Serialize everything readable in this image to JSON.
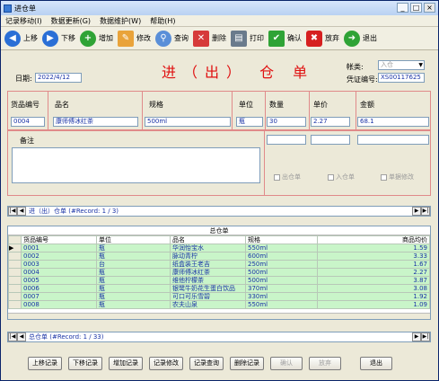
{
  "window": {
    "title": "进仓单",
    "buttons": {
      "min": "_",
      "max": "□",
      "close": "×"
    }
  },
  "menu": [
    "记录移动(I)",
    "数据更新(G)",
    "数据维护(W)",
    "帮助(H)"
  ],
  "toolbar": [
    {
      "label": "上移",
      "icon": "arrow-left-icon",
      "color": "#2a6fd6"
    },
    {
      "label": "下移",
      "icon": "arrow-right-icon",
      "color": "#2a6fd6"
    },
    {
      "label": "增加",
      "icon": "plus-icon",
      "color": "#2fa336"
    },
    {
      "label": "修改",
      "icon": "pencil-icon",
      "color": "#e9a33a"
    },
    {
      "label": "查询",
      "icon": "magnifier-icon",
      "color": "#5a8fd8"
    },
    {
      "label": "删除",
      "icon": "delete-doc-icon",
      "color": "#d63a3a"
    },
    {
      "label": "打印",
      "icon": "printer-icon",
      "color": "#6a7b8c"
    },
    {
      "label": "确认",
      "icon": "checkmark-icon",
      "color": "#2fa336"
    },
    {
      "label": "放弃",
      "icon": "x-icon",
      "color": "#d62020"
    },
    {
      "label": "退出",
      "icon": "exit-arrow-icon",
      "color": "#2fa336"
    }
  ],
  "header": {
    "date_label": "日期:",
    "date_value": "2022/4/12",
    "title": "进（出） 仓 单",
    "type_label": "帐类:",
    "type_value": "入仓",
    "voucher_label": "凭证编号:",
    "voucher_value": "XS00117625"
  },
  "detail": {
    "headers": [
      "货品编号",
      "品名",
      "规格",
      "单位",
      "数量",
      "单价",
      "金额"
    ],
    "values": [
      "0004",
      "康师傅冰红茶",
      "500ml",
      "瓶",
      "30",
      "2.27",
      "68.1"
    ],
    "remark_label": "备注",
    "remark_value": "",
    "checks": [
      "出仓单",
      "入仓单",
      "单据修改"
    ]
  },
  "nav1": {
    "text": "进（出）仓单 (#Record: 1 / 3)"
  },
  "grid": {
    "title": "总仓单",
    "columns": [
      "货品编号",
      "单位",
      "品名",
      "规格",
      "商品均价"
    ],
    "rows": [
      [
        "0001",
        "瓶",
        "华润怡宝水",
        "550ml",
        "1.59"
      ],
      [
        "0002",
        "瓶",
        "脉动青柠",
        "600ml",
        "3.33"
      ],
      [
        "0003",
        "台",
        "纸盒装王老吉",
        "250ml",
        "1.67"
      ],
      [
        "0004",
        "瓶",
        "康师傅冰红茶",
        "500ml",
        "2.27"
      ],
      [
        "0005",
        "瓶",
        "维他柠檬茶",
        "500ml",
        "3.87"
      ],
      [
        "0006",
        "瓶",
        "银鹭牛奶花生蛋白饮品",
        "370ml",
        "3.08"
      ],
      [
        "0007",
        "瓶",
        "可口可乐雪碧",
        "330ml",
        "1.92"
      ],
      [
        "0008",
        "瓶",
        "农夫山泉",
        "550ml",
        "1.09"
      ]
    ]
  },
  "nav2": {
    "text": "总仓单 (#Record: 1 / 33)"
  },
  "buttons": [
    "上移记录",
    "下移记录",
    "增加记录",
    "记录修改",
    "记录查询",
    "删除记录",
    "确认",
    "放弃",
    "退出"
  ],
  "colors": {
    "title_red": "#e01010",
    "grid_green": "#c9f5c9",
    "value_blue": "#1a33a6"
  }
}
